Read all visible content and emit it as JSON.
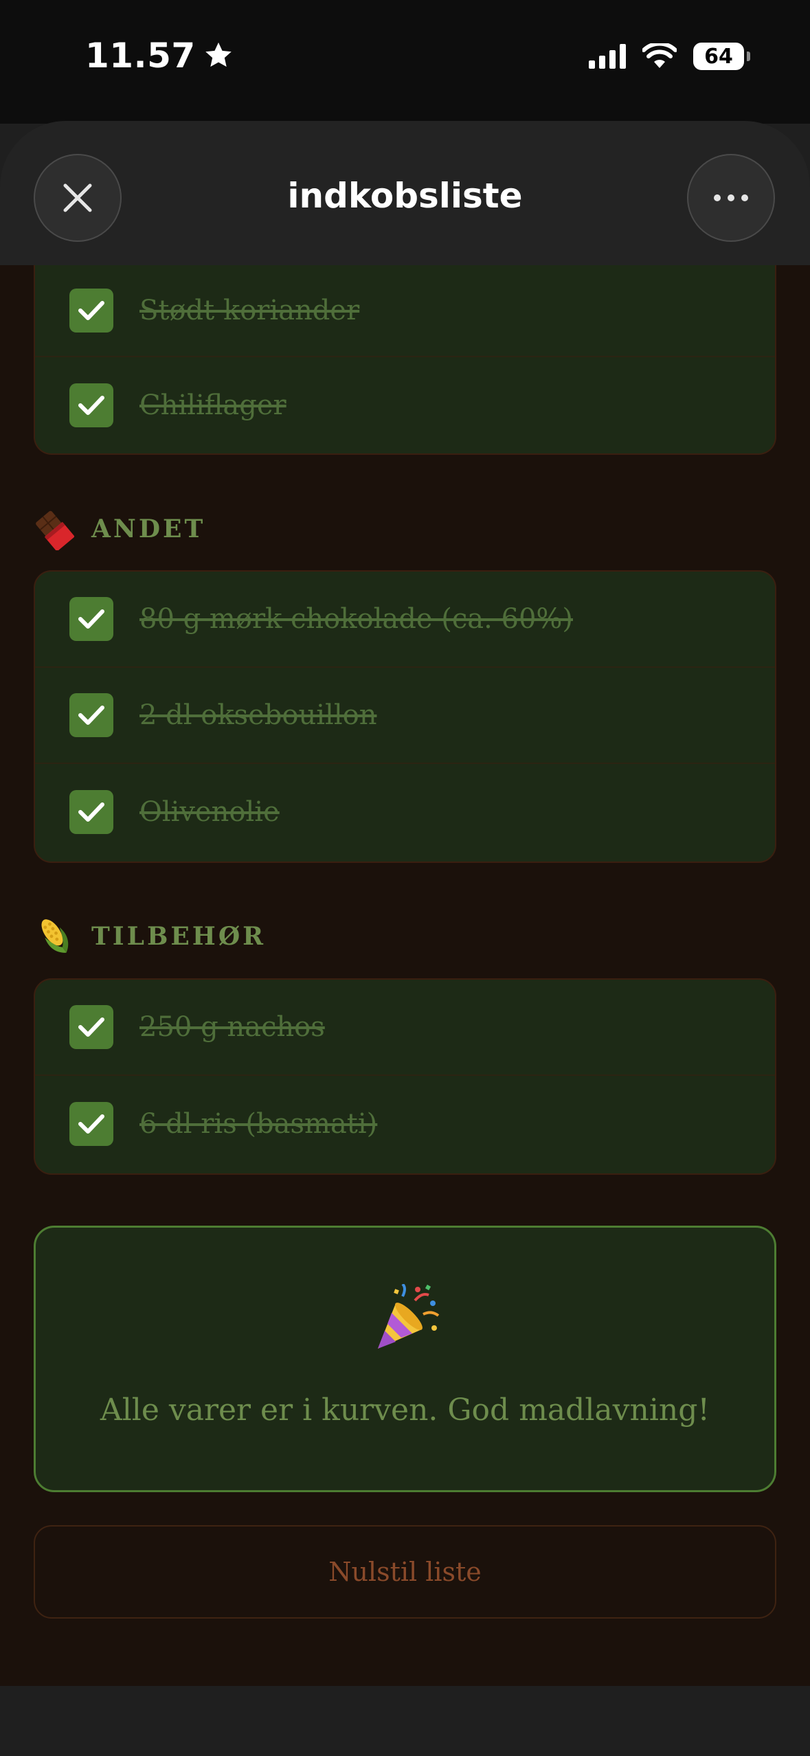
{
  "status_bar": {
    "time": "11.57",
    "battery": "64"
  },
  "header": {
    "title": "indkobsliste"
  },
  "sections": [
    {
      "title": "",
      "items": [
        {
          "label": "Stødt koriander",
          "checked": true
        },
        {
          "label": "Chiliflager",
          "checked": true
        }
      ]
    },
    {
      "title": "ANDET",
      "icon": "chocolate-bar-icon",
      "items": [
        {
          "label": "80 g mørk chokolade (ca. 60%)",
          "checked": true
        },
        {
          "label": "2 dl oksebouillon",
          "checked": true
        },
        {
          "label": "Olivenolie",
          "checked": true
        }
      ]
    },
    {
      "title": "TILBEHØR",
      "icon": "corn-icon",
      "items": [
        {
          "label": "250 g nachos",
          "checked": true
        },
        {
          "label": "6 dl ris (basmati)",
          "checked": true
        }
      ]
    }
  ],
  "completion": {
    "icon": "party-popper-icon",
    "message": "Alle varer er i kurven. God madlavning!"
  },
  "reset_label": "Nulstil liste",
  "colors": {
    "background": "#1b110b",
    "card": "#1d2a16",
    "accent_green": "#4d7d32",
    "muted_text": "#4f6e3a",
    "reset_text": "#8a4a2a"
  }
}
